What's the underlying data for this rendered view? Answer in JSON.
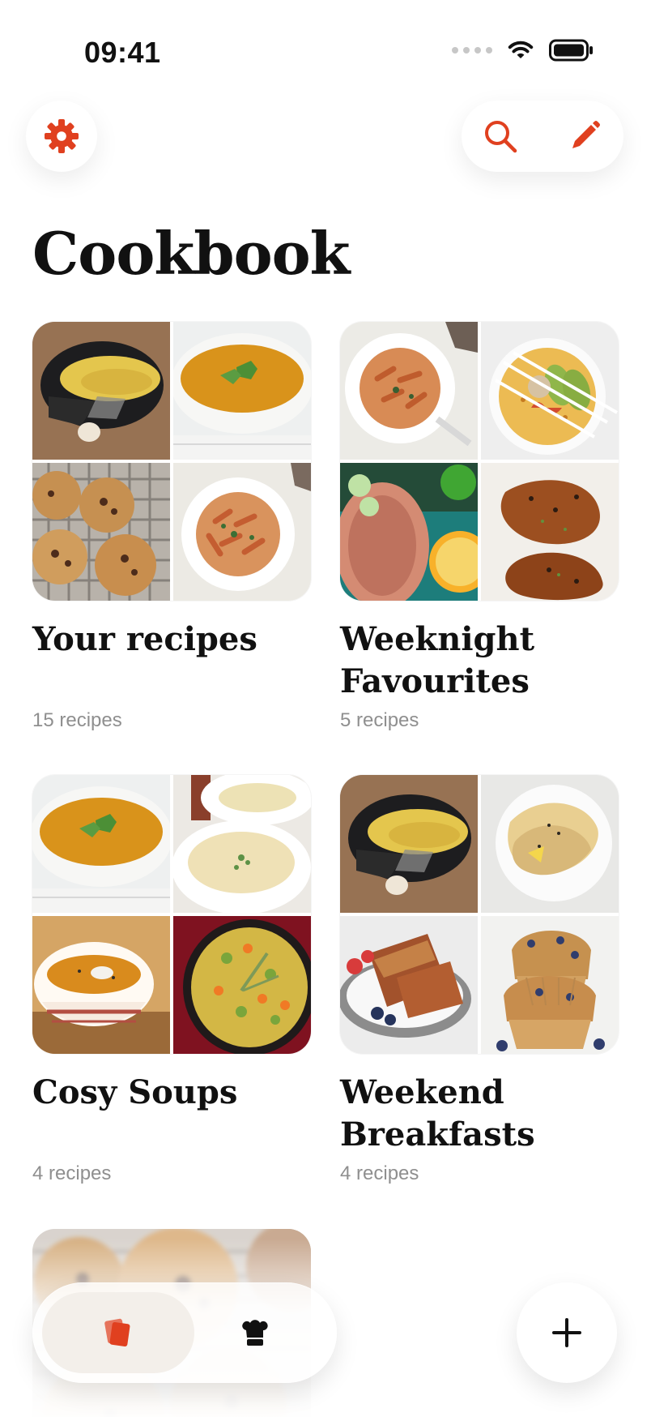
{
  "status_bar": {
    "time": "09:41",
    "icons": [
      "signal-dots-icon",
      "wifi-icon",
      "battery-icon"
    ]
  },
  "header": {
    "settings_icon": "gear-icon",
    "search_icon": "search-icon",
    "edit_icon": "pencil-icon"
  },
  "page": {
    "title": "Cookbook"
  },
  "collections": [
    {
      "title": "Your recipes",
      "count": "15 recipes",
      "images": [
        "omelette-pan",
        "carrot-soup",
        "chocolate-chip-cookies",
        "pasta-bowl"
      ]
    },
    {
      "title": "Weeknight Favourites",
      "count": "5 recipes",
      "images": [
        "pasta-bowl",
        "avocado-tortilla",
        "fish-with-lemon",
        "crispy-chicken"
      ]
    },
    {
      "title": "Cosy Soups",
      "count": "4 recipes",
      "images": [
        "carrot-soup",
        "cream-soup",
        "pumpkin-soup-bowl",
        "vegetable-stew-pot"
      ]
    },
    {
      "title": "Weekend Breakfasts",
      "count": "4 recipes",
      "images": [
        "omelette-pan",
        "crepes",
        "french-toast",
        "blueberry-muffins"
      ]
    }
  ],
  "partial_collection": {
    "image": "chocolate-chip-cookies-blurred"
  },
  "tabbar": {
    "tabs": [
      "collections-icon",
      "chef-hat-icon"
    ],
    "active_tab": "collections-icon"
  },
  "fab": {
    "icon": "plus-icon"
  },
  "colors": {
    "accent": "#e0401f",
    "text": "#111111",
    "muted": "#8f8f8f",
    "background": "#ffffff"
  }
}
